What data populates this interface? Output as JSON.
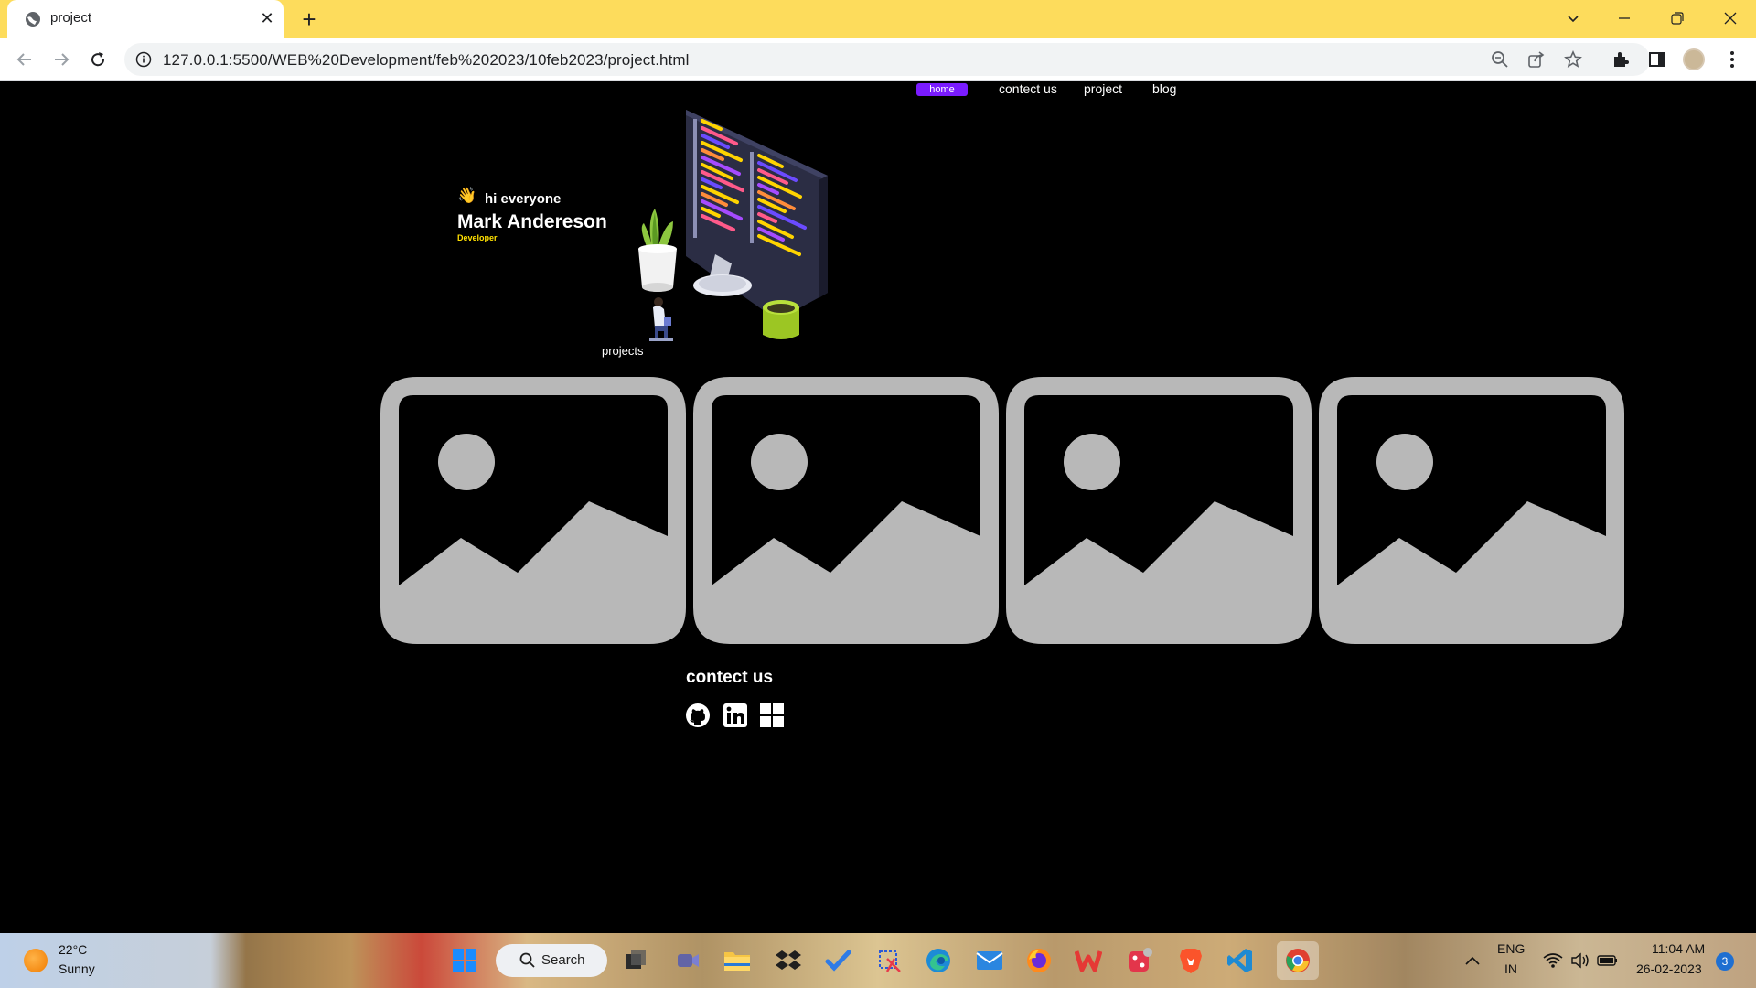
{
  "browser": {
    "tab_title": "project",
    "url": "127.0.0.1:5500/WEB%20Development/feb%202023/10feb2023/project.html"
  },
  "nav": {
    "items": [
      {
        "label": "home",
        "active": true
      },
      {
        "label": "contect us",
        "active": false
      },
      {
        "label": "project",
        "active": false
      },
      {
        "label": "blog",
        "active": false
      }
    ]
  },
  "hero": {
    "wave_emoji": "👋",
    "greeting": "hi everyone",
    "name": "Mark Andereson",
    "role": "Developer"
  },
  "projects": {
    "label": "projects",
    "cards": [
      {
        "icon": "image-placeholder-icon"
      },
      {
        "icon": "image-placeholder-icon"
      },
      {
        "icon": "image-placeholder-icon"
      },
      {
        "icon": "image-placeholder-icon"
      }
    ]
  },
  "contact": {
    "title": "contect us",
    "links": [
      "github-icon",
      "linkedin-icon",
      "windows-icon"
    ]
  },
  "taskbar": {
    "temperature": "22°C",
    "condition": "Sunny",
    "search_label": "Search",
    "lang_top": "ENG",
    "lang_bottom": "IN",
    "time": "11:04 AM",
    "date": "26-02-2023",
    "notification_count": "3"
  },
  "colors": {
    "tabstrip": "#fddc5c",
    "active_nav": "#7a1bff",
    "role": "#ffe000",
    "placeholder": "#b8b8b8"
  }
}
